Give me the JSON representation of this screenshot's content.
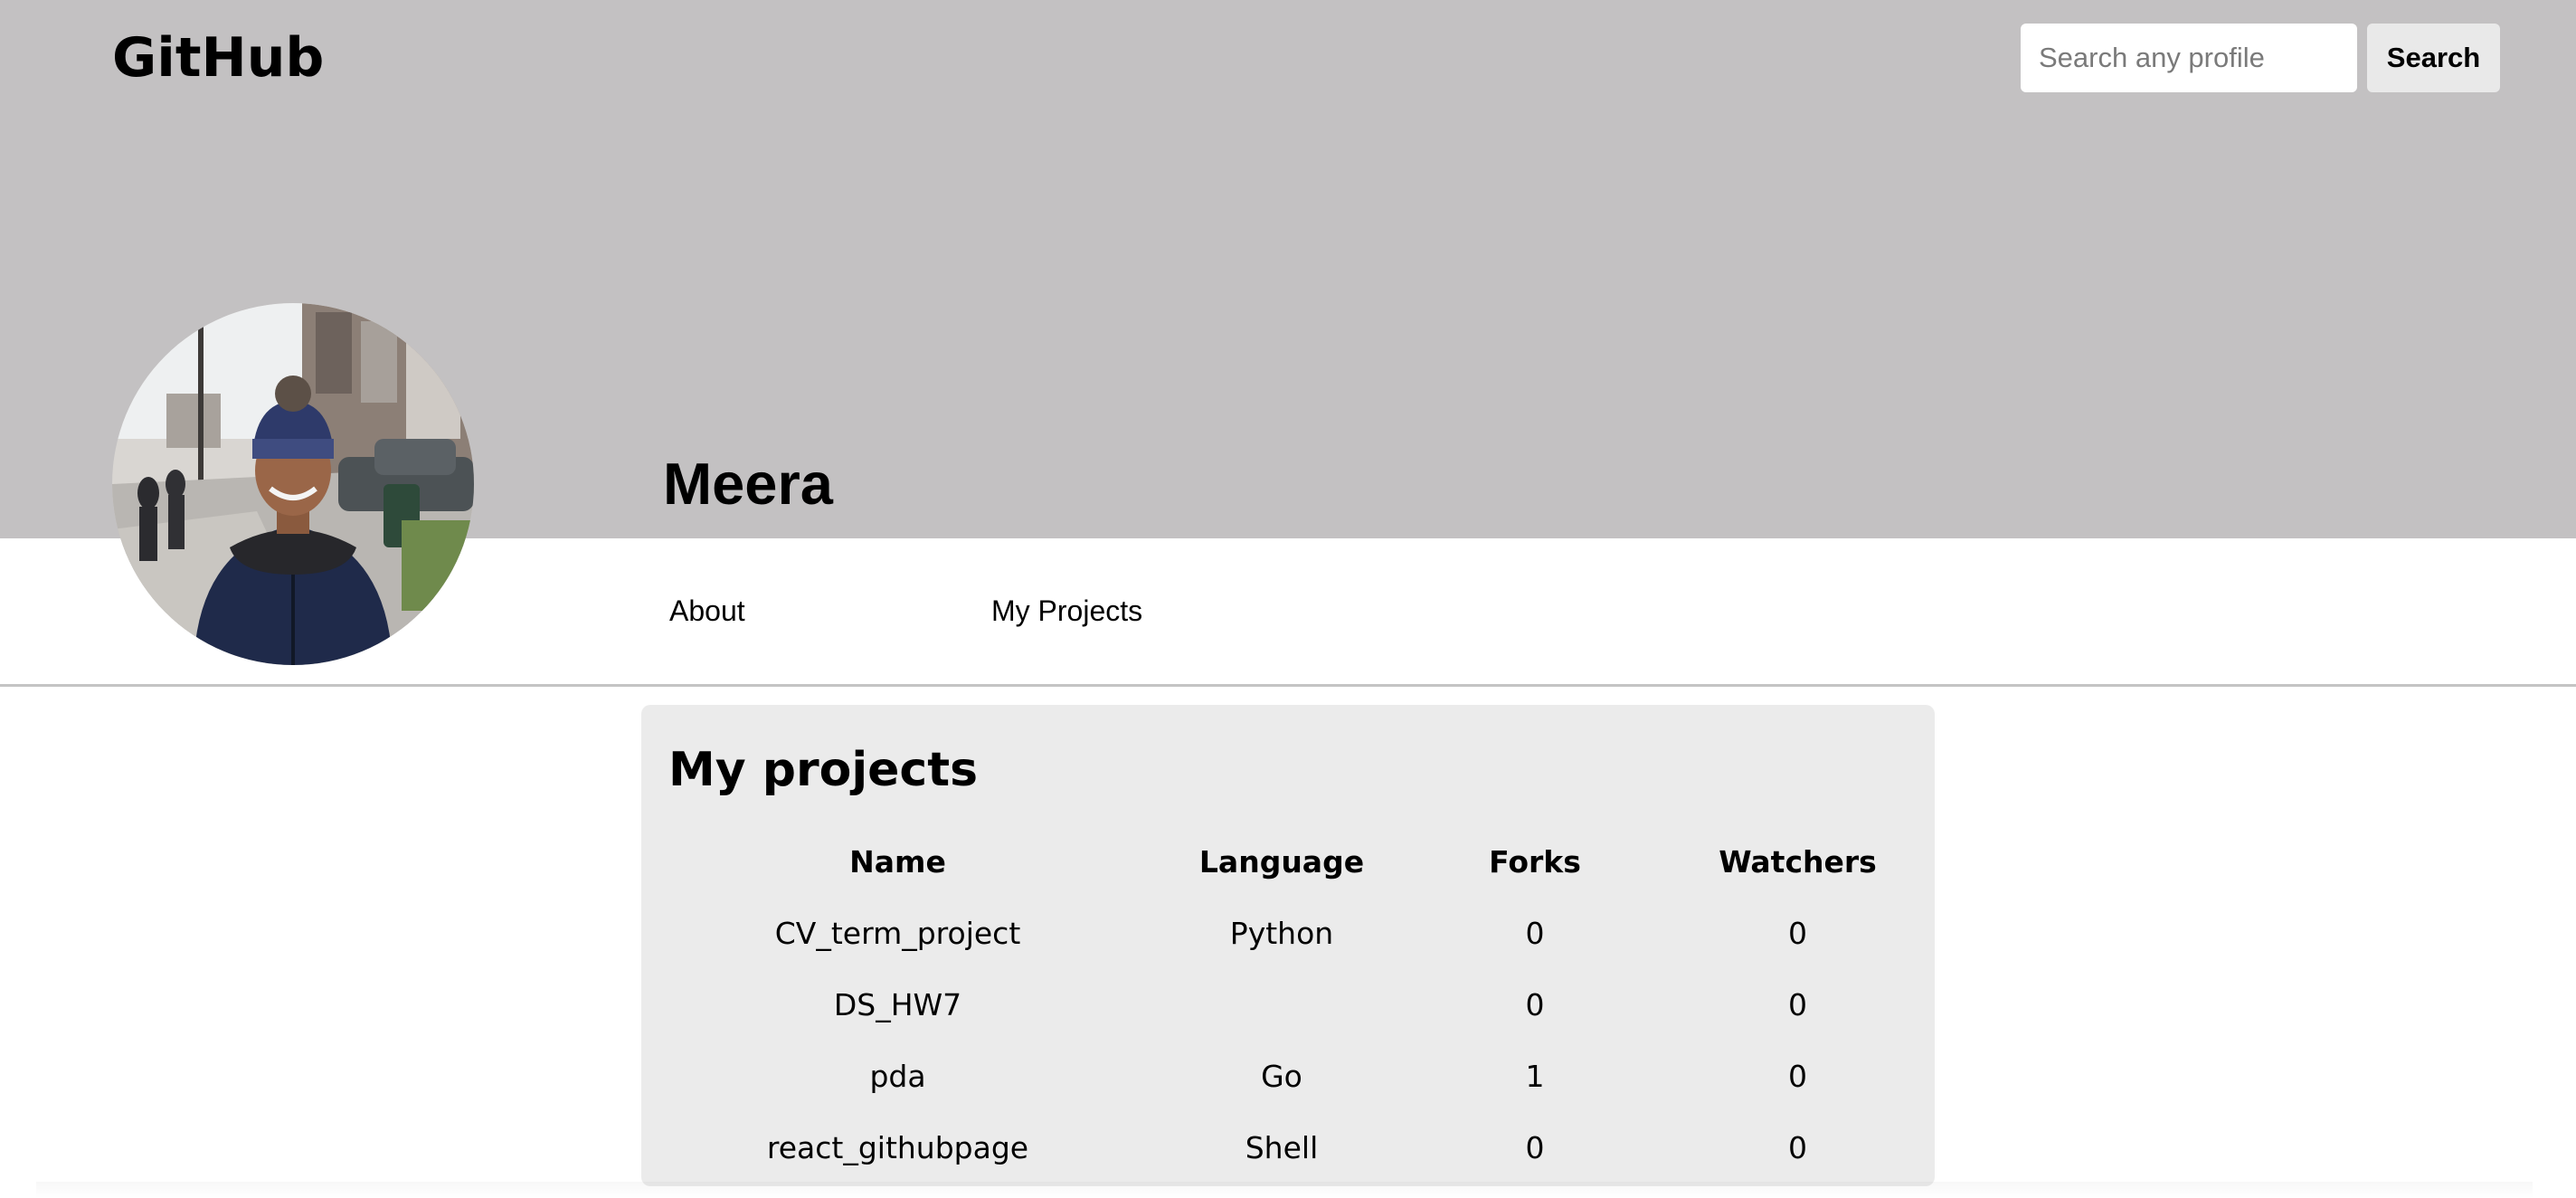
{
  "header": {
    "logo_text": "GitHub",
    "search_placeholder": "Search any profile",
    "search_value": "",
    "search_button_label": "Search"
  },
  "profile": {
    "name": "Meera",
    "avatar_alt": "Profile photo"
  },
  "nav": {
    "tabs": [
      {
        "label": "About"
      },
      {
        "label": "My Projects"
      }
    ]
  },
  "projects": {
    "title": "My projects",
    "columns": [
      "Name",
      "Language",
      "Forks",
      "Watchers"
    ],
    "rows": [
      {
        "name": "CV_term_project",
        "language": "Python",
        "forks": "0",
        "watchers": "0"
      },
      {
        "name": "DS_HW7",
        "language": "",
        "forks": "0",
        "watchers": "0"
      },
      {
        "name": "pda",
        "language": "Go",
        "forks": "1",
        "watchers": "0"
      },
      {
        "name": "react_githubpage",
        "language": "Shell",
        "forks": "0",
        "watchers": "0"
      }
    ]
  },
  "colors": {
    "banner": "#c3c1c2",
    "card": "#ebebeb",
    "search_button": "#e9e9e9",
    "divider": "#c4c4c4"
  },
  "icons": {
    "avatar": "person-photo"
  }
}
